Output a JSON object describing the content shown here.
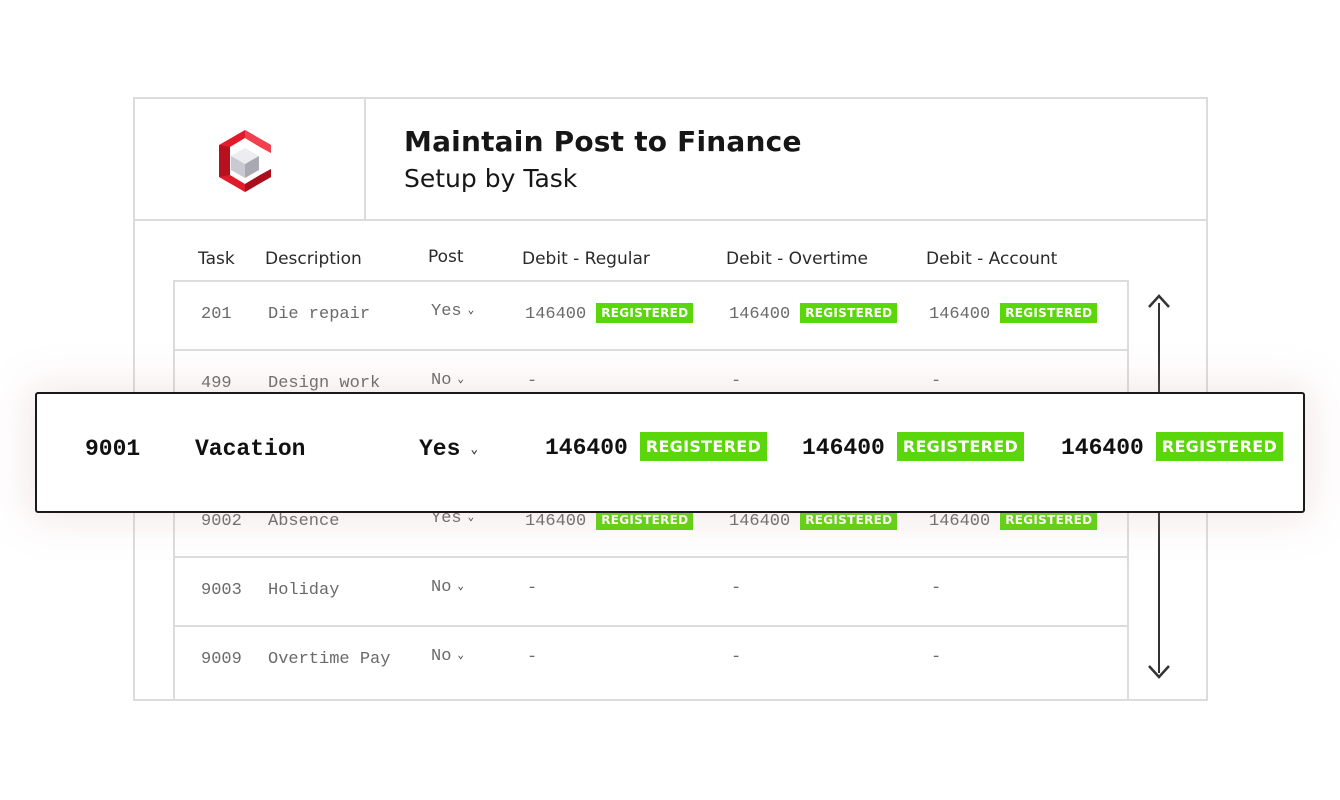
{
  "header": {
    "title": "Maintain Post to Finance",
    "subtitle": "Setup by Task",
    "logo_icon": "cube-logo-icon",
    "brand_color": "#e01b2c"
  },
  "columns": [
    "Task",
    "Description",
    "Post",
    "Debit - Regular",
    "Debit - Overtime",
    "Debit - Account"
  ],
  "rows": [
    {
      "task": "201",
      "description": "Die repair",
      "post": "Yes",
      "regular": "146400",
      "regular_status": "REGISTERED",
      "overtime": "146400",
      "overtime_status": "REGISTERED",
      "account": "146400",
      "account_status": "REGISTERED"
    },
    {
      "task": "499",
      "description": "Design work",
      "post": "No",
      "regular": "-",
      "overtime": "-",
      "account": "-"
    },
    {
      "task": "9002",
      "description": "Absence",
      "post": "Yes",
      "regular": "146400",
      "regular_status": "REGISTERED",
      "overtime": "146400",
      "overtime_status": "REGISTERED",
      "account": "146400",
      "account_status": "REGISTERED"
    },
    {
      "task": "9003",
      "description": "Holiday",
      "post": "No",
      "regular": "-",
      "overtime": "-",
      "account": "-"
    },
    {
      "task": "9009",
      "description": "Overtime Pay",
      "post": "No",
      "regular": "-",
      "overtime": "-",
      "account": "-"
    }
  ],
  "highlighted_row": {
    "task": "9001",
    "description": "Vacation",
    "post": "Yes",
    "regular": "146400",
    "regular_status": "REGISTERED",
    "overtime": "146400",
    "overtime_status": "REGISTERED",
    "account": "146400",
    "account_status": "REGISTERED"
  },
  "colors": {
    "registered_badge": "#5ad60b",
    "border": "#dcdcdc"
  },
  "icons": {
    "dropdown": "chevron-down-icon",
    "scroll_up": "chevron-up-icon",
    "scroll_down": "chevron-down-icon"
  }
}
